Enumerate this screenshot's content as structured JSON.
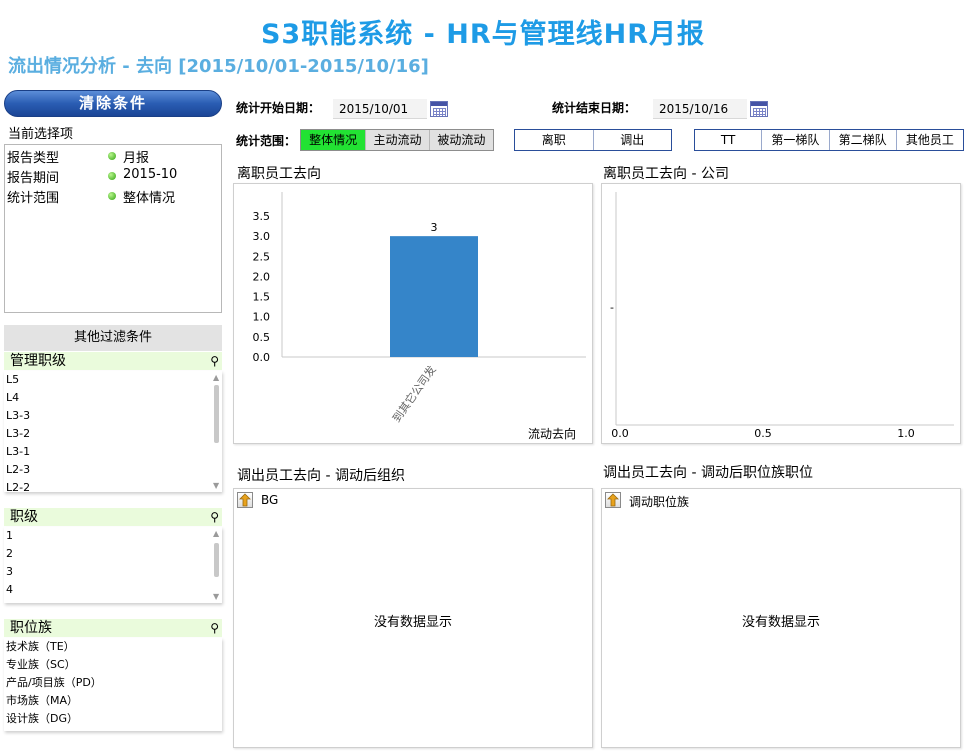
{
  "header": {
    "title": "S3职能系统 - HR与管理线HR月报",
    "subtitle": "流出情况分析 - 去向 [2015/10/01-2015/10/16]"
  },
  "sidebar": {
    "clear_button": "清除条件",
    "current_selection_label": "当前选择项",
    "selections": [
      {
        "key": "报告类型",
        "value": "月报"
      },
      {
        "key": "报告期间",
        "value": "2015-10"
      },
      {
        "key": "统计范围",
        "value": "整体情况"
      }
    ],
    "other_filters_label": "其他过滤条件",
    "listboxes": [
      {
        "title": "管理职级",
        "items": [
          "L5",
          "L4",
          "L3-3",
          "L3-2",
          "L3-1",
          "L2-3",
          "L2-2"
        ]
      },
      {
        "title": "职级",
        "items": [
          "1",
          "2",
          "3",
          "4"
        ]
      },
      {
        "title": "职位族",
        "items": [
          "技术族（TE）",
          "专业族（SC）",
          "产品/项目族（PD）",
          "市场族（MA）",
          "设计族（DG）"
        ]
      }
    ]
  },
  "filters": {
    "start_label": "统计开始日期：",
    "start_value": "2015/10/01",
    "end_label": "统计结束日期：",
    "end_value": "2015/10/16",
    "scope_label": "统计范围：",
    "scope_options": [
      "整体情况",
      "主动流动",
      "被动流动"
    ],
    "scope_selected": "整体情况",
    "type_options": [
      "离职",
      "调出"
    ],
    "team_options": [
      "TT",
      "第一梯队",
      "第二梯队",
      "其他员工"
    ]
  },
  "panels": {
    "p1_title": "离职员工去向",
    "p2_title": "离职员工去向 - 公司",
    "p3_title": "调出员工去向 - 调动后组织",
    "p4_title": "调出员工去向 - 调动后职位族职位",
    "p3_header": "BG",
    "p4_header": "调动职位族",
    "no_data": "没有数据显示",
    "p2_placeholder_dash": "-"
  },
  "chart_data": [
    {
      "type": "bar",
      "categories": [
        "到其它公司发"
      ],
      "values": [
        3
      ],
      "data_labels": [
        "3"
      ],
      "xlabel": "流动去向",
      "ylabel": "",
      "ylim": [
        0,
        3.5
      ],
      "yticks": [
        "3.5",
        "3.0",
        "2.5",
        "2.0",
        "1.5",
        "1.0",
        "0.5",
        "0.0"
      ],
      "bar_color": "#3585c9"
    },
    {
      "type": "bar",
      "categories": [],
      "values": [],
      "xlim": [
        0,
        1
      ],
      "xticks": [
        "0.0",
        "0.5",
        "1.0"
      ]
    }
  ]
}
